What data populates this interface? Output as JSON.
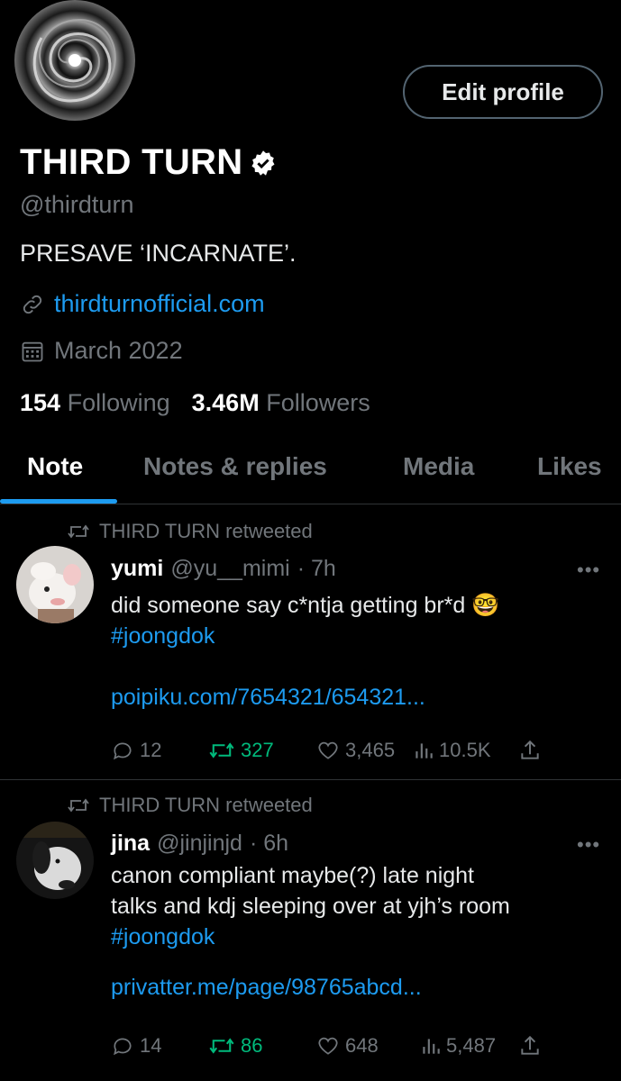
{
  "profile": {
    "name": "THIRD TURN",
    "handle": "@thirdturn",
    "bio": "PRESAVE ‘INCARNATE’.",
    "website": "thirdturnofficial.com",
    "joined": "March 2022",
    "following_count": "154",
    "following_label": "Following",
    "followers_count": "3.46M",
    "followers_label": "Followers",
    "edit_button": "Edit profile"
  },
  "tabs": [
    "Note",
    "Notes & replies",
    "Media",
    "Likes"
  ],
  "active_tab": "Note",
  "colors": {
    "accent": "#1d9bf0",
    "retweet": "#00ba7c",
    "muted": "#71767b",
    "background": "#000000"
  },
  "posts": [
    {
      "retweeted_by": "THIRD TURN retweeted",
      "name": "yumi",
      "handle": "@yu__mimi",
      "time": "· 7h",
      "text": "did someone say c*ntja getting br*d 🤓",
      "hashtag": "#joongdok",
      "link": "poipiku.com/7654321/654321...",
      "replies": "12",
      "retweets": "327",
      "likes": "3,465",
      "views": "10.5K",
      "more": "•••"
    },
    {
      "retweeted_by": "THIRD TURN retweeted",
      "name": "jina",
      "handle": "@jinjinjd",
      "time": "· 6h",
      "text_line1": "canon compliant maybe(?) late night",
      "text_line2": "talks and kdj sleeping over at yjh’s room",
      "hashtag": "#joongdok",
      "link": "privatter.me/page/98765abcd...",
      "replies": "14",
      "retweets": "86",
      "likes": "648",
      "views": "5,487",
      "more": "•••"
    }
  ]
}
